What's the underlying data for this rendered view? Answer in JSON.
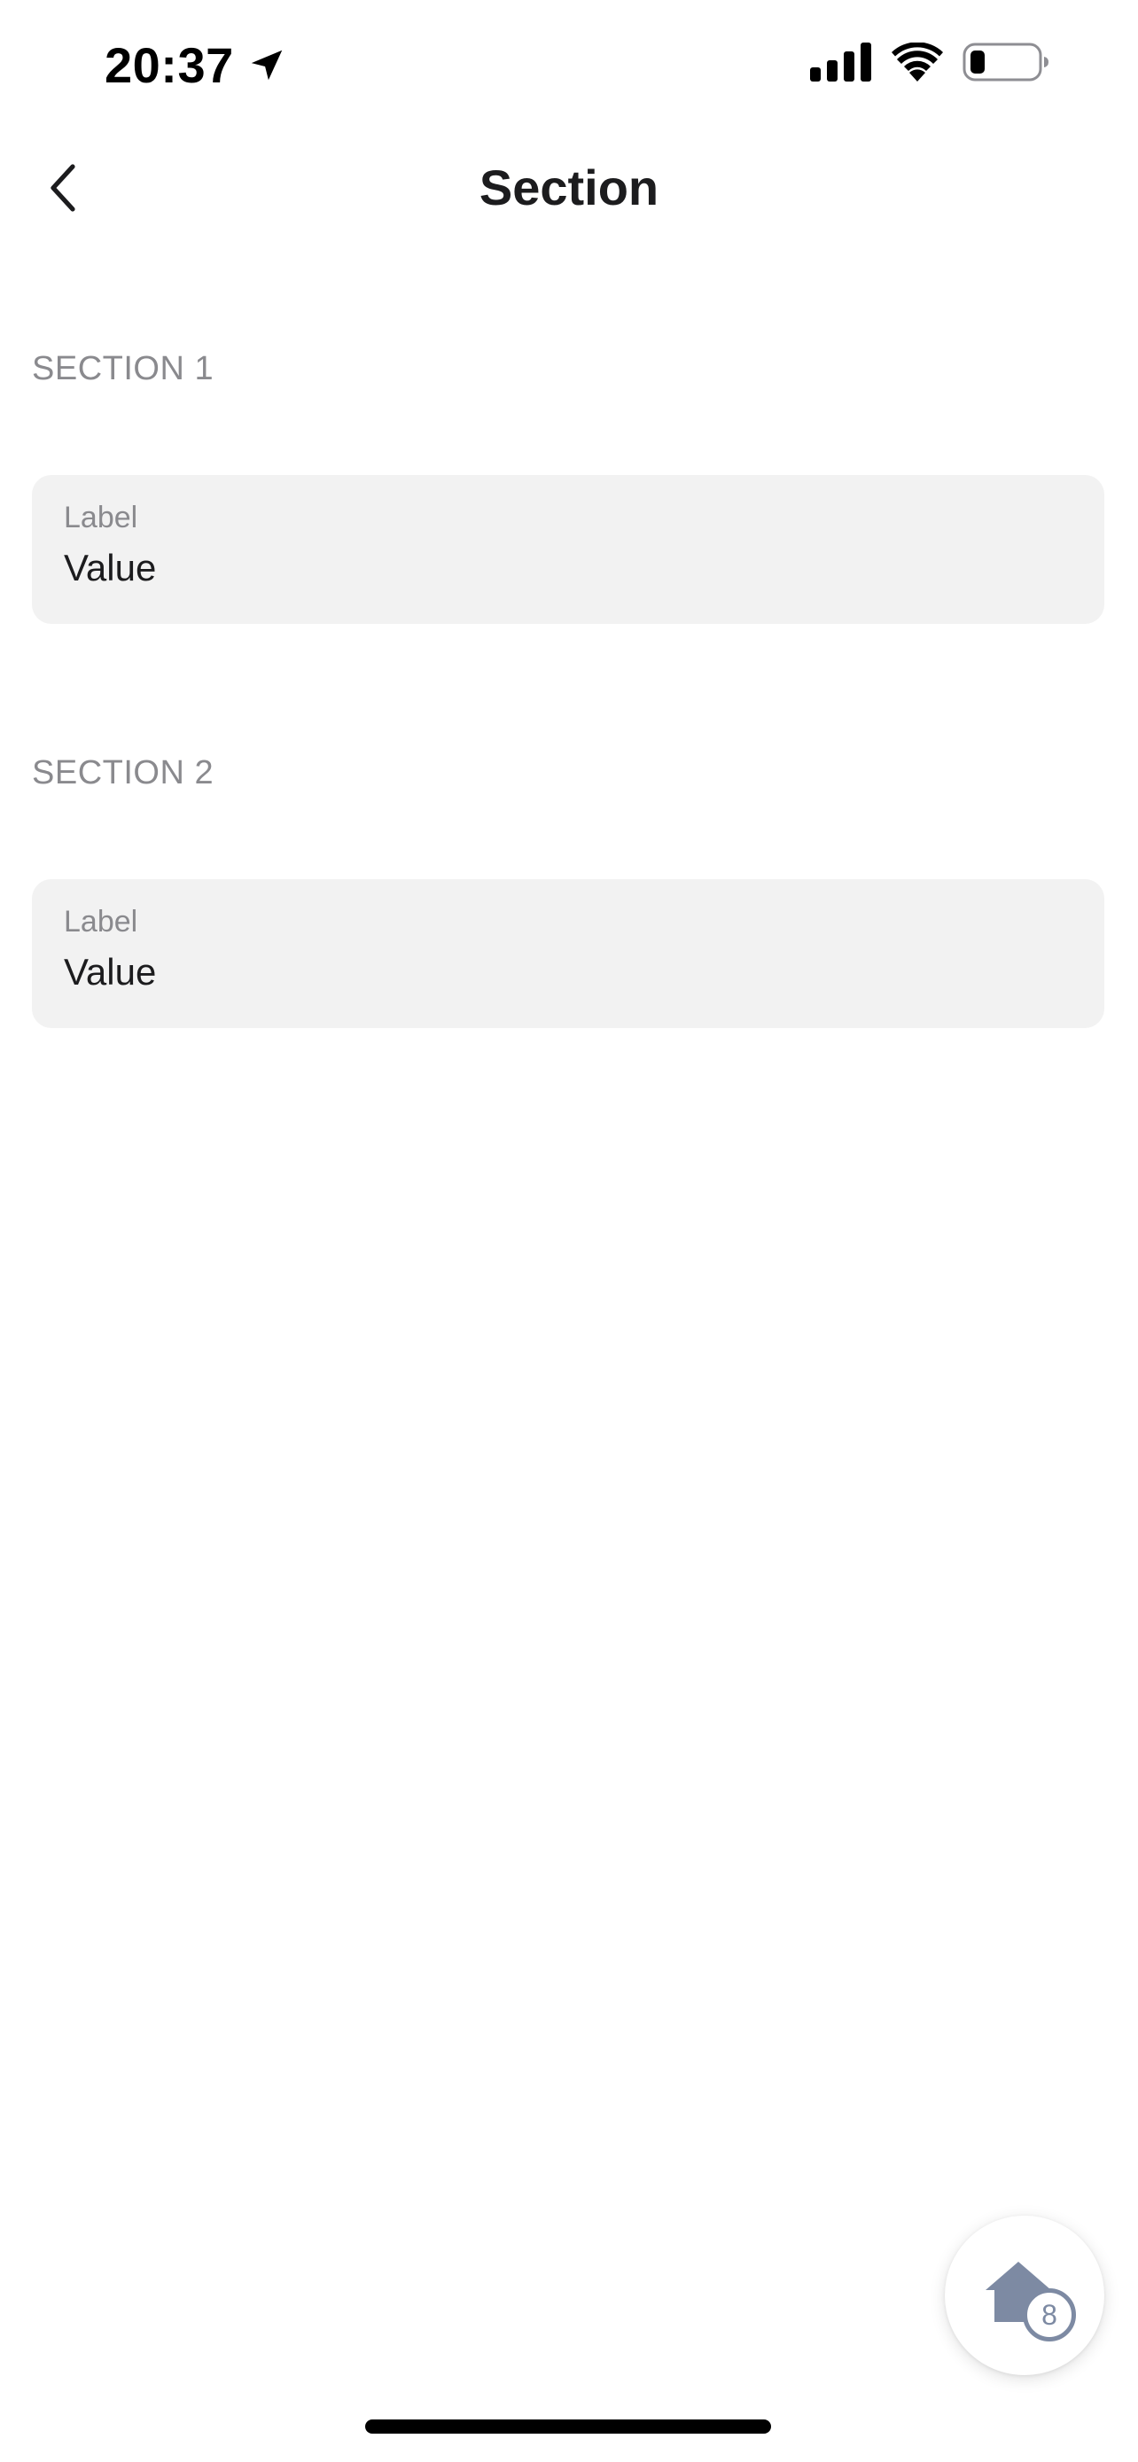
{
  "status_bar": {
    "time": "20:37",
    "icons": [
      "location-arrow-icon",
      "cellular-signal-icon",
      "wifi-icon",
      "battery-icon"
    ]
  },
  "nav": {
    "title": "Section",
    "back_icon": "chevron-left-icon"
  },
  "sections": [
    {
      "header": "SECTION 1",
      "field": {
        "label": "Label",
        "value": "Value"
      }
    },
    {
      "header": "SECTION 2",
      "field": {
        "label": "Label",
        "value": "Value"
      }
    }
  ],
  "fab": {
    "icon": "home-icon",
    "badge": "8"
  },
  "colors": {
    "background": "#ffffff",
    "card": "#f2f2f2",
    "secondary_text": "#8a8a8e",
    "primary_text": "#1c1c1e",
    "fab_icon": "#7d8aa3"
  }
}
